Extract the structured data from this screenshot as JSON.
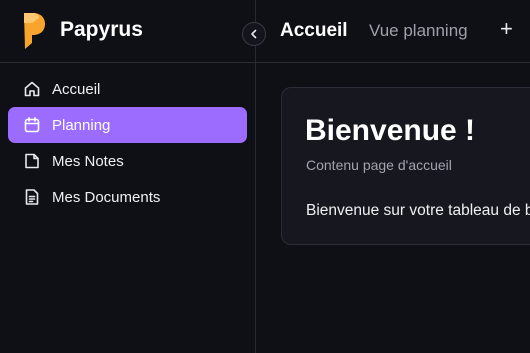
{
  "app": {
    "name": "Papyrus",
    "logo_color": "#f7a52d"
  },
  "sidebar": {
    "collapse_icon": "chevron-left-icon",
    "items": [
      {
        "label": "Accueil",
        "icon": "home-icon",
        "active": false
      },
      {
        "label": "Planning",
        "icon": "calendar-icon",
        "active": true
      },
      {
        "label": "Mes Notes",
        "icon": "note-icon",
        "active": false
      },
      {
        "label": "Mes Documents",
        "icon": "document-icon",
        "active": false
      }
    ],
    "active_color": "#9b6cff"
  },
  "header": {
    "tabs": [
      {
        "label": "Accueil",
        "active": true
      },
      {
        "label": "Vue planning",
        "active": false
      }
    ],
    "add_label": "+"
  },
  "main": {
    "title": "Bienvenue !",
    "subtitle": "Contenu page d'accueil",
    "body": "Bienvenue sur votre tableau de bord"
  }
}
